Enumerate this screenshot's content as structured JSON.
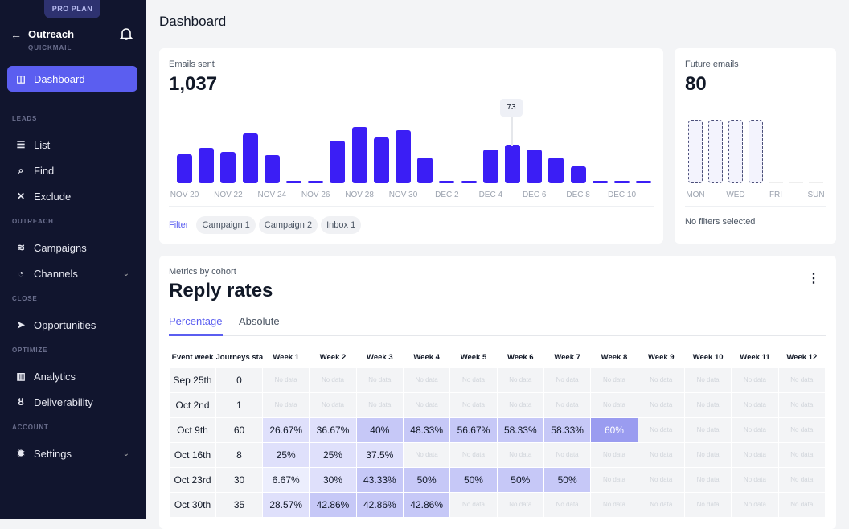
{
  "sidebar": {
    "plan": "PRO PLAN",
    "back_icon": "arrow-left-icon",
    "title": "Outreach",
    "subtitle": "QUICKMAIL",
    "bell_icon": "bell-icon",
    "items": [
      {
        "label": "Dashboard",
        "icon": "dashboard-icon",
        "glyph": "◫",
        "active": true
      },
      {
        "section": "LEADS"
      },
      {
        "label": "List",
        "icon": "list-icon",
        "glyph": "☰"
      },
      {
        "label": "Find",
        "icon": "search-icon",
        "glyph": "⌕"
      },
      {
        "label": "Exclude",
        "icon": "x-icon",
        "glyph": "✕"
      },
      {
        "section": "OUTREACH"
      },
      {
        "label": "Campaigns",
        "icon": "layers-icon",
        "glyph": "≋"
      },
      {
        "label": "Channels",
        "icon": "rss-icon",
        "glyph": "◔",
        "chevron": true
      },
      {
        "section": "CLOSE"
      },
      {
        "label": "Opportunities",
        "icon": "paper-plane-icon",
        "glyph": "➤"
      },
      {
        "section": "OPTIMIZE"
      },
      {
        "label": "Analytics",
        "icon": "bar-chart-icon",
        "glyph": "▥"
      },
      {
        "label": "Deliverability",
        "icon": "medal-icon",
        "glyph": "ȣ"
      },
      {
        "section": "ACCOUNT"
      },
      {
        "label": "Settings",
        "icon": "gear-icon",
        "glyph": "✹",
        "chevron": true
      }
    ]
  },
  "header": {
    "title": "Dashboard"
  },
  "emails_sent": {
    "label": "Emails sent",
    "value": "1,037",
    "tooltip": "73",
    "filter_label": "Filter",
    "filters": [
      "Campaign 1",
      "Campaign 2",
      "Inbox 1"
    ]
  },
  "future_emails": {
    "label": "Future emails",
    "value": "80",
    "day_labels": [
      "MON",
      "WED",
      "FRI",
      "SUN"
    ],
    "scheduled_days": [
      true,
      true,
      true,
      true,
      false,
      false,
      false
    ],
    "footer": "No filters selected"
  },
  "cohort": {
    "label": "Metrics by cohort",
    "title": "Reply rates",
    "menu_icon": "more-vertical-icon",
    "tabs": [
      "Percentage",
      "Absolute"
    ],
    "active_tab": 0,
    "columns": [
      "Event week",
      "Journeys started",
      "Week 1",
      "Week 2",
      "Week 3",
      "Week 4",
      "Week 5",
      "Week 6",
      "Week 7",
      "Week 8",
      "Week 9",
      "Week 10",
      "Week 11",
      "Week 12"
    ],
    "no_data": "No data",
    "rows": [
      {
        "week": "Sep 25th",
        "started": "0",
        "values": [
          null,
          null,
          null,
          null,
          null,
          null,
          null,
          null,
          null,
          null,
          null,
          null
        ]
      },
      {
        "week": "Oct 2nd",
        "started": "1",
        "values": [
          null,
          null,
          null,
          null,
          null,
          null,
          null,
          null,
          null,
          null,
          null,
          null
        ]
      },
      {
        "week": "Oct 9th",
        "started": "60",
        "values": [
          "26.67%",
          "36.67%",
          "40%",
          "48.33%",
          "56.67%",
          "58.33%",
          "58.33%",
          "60%",
          null,
          null,
          null,
          null
        ]
      },
      {
        "week": "Oct 16th",
        "started": "8",
        "values": [
          "25%",
          "25%",
          "37.5%",
          null,
          null,
          null,
          null,
          null,
          null,
          null,
          null,
          null
        ]
      },
      {
        "week": "Oct 23rd",
        "started": "30",
        "values": [
          "6.67%",
          "30%",
          "43.33%",
          "50%",
          "50%",
          "50%",
          "50%",
          null,
          null,
          null,
          null,
          null
        ]
      },
      {
        "week": "Oct 30th",
        "started": "35",
        "values": [
          "28.57%",
          "42.86%",
          "42.86%",
          "42.86%",
          null,
          null,
          null,
          null,
          null,
          null,
          null,
          null
        ]
      }
    ]
  },
  "chart_data": {
    "type": "bar",
    "title": "Emails sent",
    "categories": [
      "Nov 20",
      "Nov 21",
      "Nov 22",
      "Nov 23",
      "Nov 24",
      "Nov 25",
      "Nov 26",
      "Nov 27",
      "Nov 28",
      "Nov 29",
      "Nov 30",
      "Dec 1",
      "Dec 2",
      "Dec 3",
      "Dec 4",
      "Dec 5",
      "Dec 6",
      "Dec 7",
      "Dec 8",
      "Dec 9",
      "Dec 10",
      "Dec 11"
    ],
    "tick_labels": [
      "NOV 20",
      "NOV 22",
      "NOV 24",
      "NOV 26",
      "NOV 28",
      "NOV 30",
      "DEC 2",
      "DEC 4",
      "DEC 6",
      "DEC 8",
      "DEC 10"
    ],
    "values": [
      55,
      67,
      59,
      94,
      53,
      0,
      0,
      81,
      106,
      87,
      100,
      49,
      0,
      0,
      64,
      73,
      64,
      49,
      32,
      0,
      0,
      0
    ],
    "highlighted": "Dec 5",
    "bar_color": "#3b1ef5",
    "grid": false
  }
}
